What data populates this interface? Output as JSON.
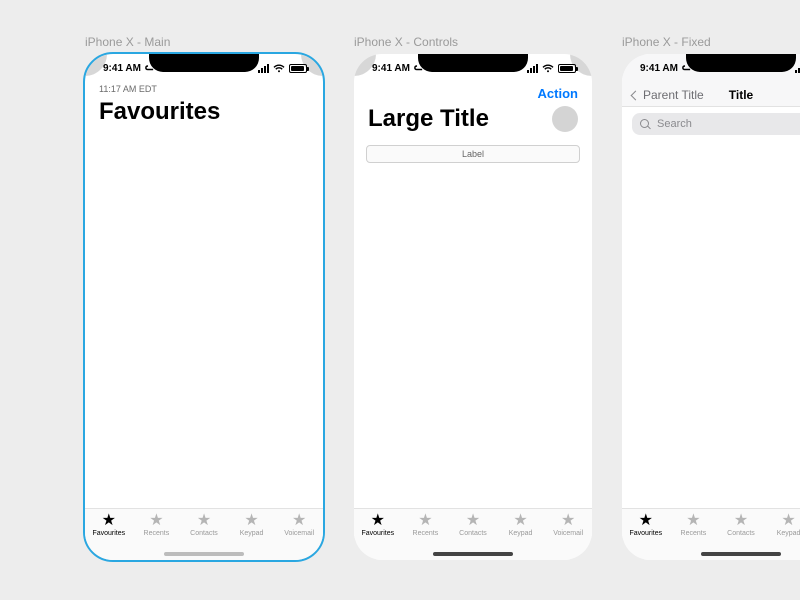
{
  "labels": {
    "artboard1": "iPhone X - Main",
    "artboard2": "iPhone X - Controls",
    "artboard3": "iPhone X - Fixed"
  },
  "status": {
    "time": "9:41 AM"
  },
  "phone1": {
    "subtime": "11:17 AM EDT",
    "title": "Favourites"
  },
  "phone2": {
    "action": "Action",
    "title": "Large Title",
    "segment_label": "Label"
  },
  "phone3": {
    "back_label": "Parent Title",
    "title": "Title",
    "search_placeholder": "Search"
  },
  "tabs": [
    {
      "label": "Favourites",
      "active": true
    },
    {
      "label": "Recents",
      "active": false
    },
    {
      "label": "Contacts",
      "active": false
    },
    {
      "label": "Keypad",
      "active": false
    },
    {
      "label": "Voicemail",
      "active": false
    }
  ]
}
